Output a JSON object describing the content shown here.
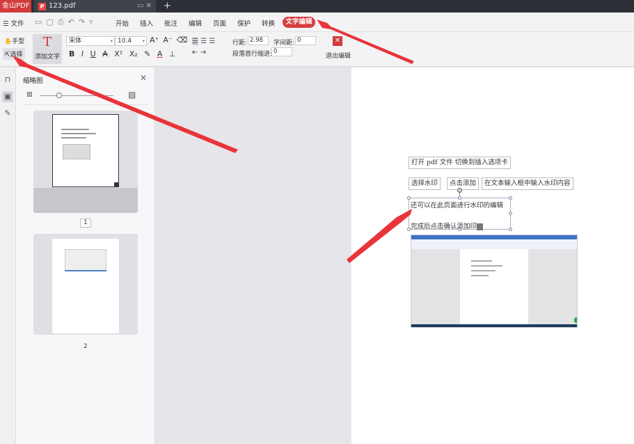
{
  "titlebar": {
    "app_name": "金山PDF",
    "doc_tab_title": "123.pdf",
    "tab_controls": "▭ ✕",
    "new_tab": "+"
  },
  "menubar": {
    "file": "☰ 文件",
    "tabs": [
      {
        "label": "开始"
      },
      {
        "label": "插入"
      },
      {
        "label": "批注"
      },
      {
        "label": "编辑"
      },
      {
        "label": "页面"
      },
      {
        "label": "保护"
      },
      {
        "label": "转换"
      }
    ],
    "active_tab": "文字编辑"
  },
  "ribbon": {
    "hand": "手型",
    "select": "选择",
    "add_text": "添加文字",
    "font_family": "宋体",
    "font_size": "10.4",
    "line_spacing_label": "行距:",
    "line_spacing_value": "2.98",
    "char_spacing_label": "字间距:",
    "char_spacing_value": "0",
    "indent_label": "段落首行缩进:",
    "indent_value": "0",
    "exit_edit": "退出编辑",
    "format_buttons": [
      "B",
      "I",
      "U",
      "A",
      "X²",
      "X₂"
    ]
  },
  "thumbnail_panel": {
    "title": "缩略图",
    "pages": [
      {
        "label": "1"
      },
      {
        "label": "2"
      }
    ]
  },
  "document": {
    "lines": [
      {
        "text": "打开 pdf 文件   切换到插入选项卡"
      },
      {
        "text": "选择水印"
      },
      {
        "text": "点击添加"
      },
      {
        "text": "在文本输入框中输入水印内容"
      },
      {
        "text": "还可以在此页面进行水印的编辑"
      },
      {
        "text": "完成后点击确认添加印"
      }
    ]
  },
  "colors": {
    "accent_red": "#d63d3d",
    "arrow_red": "#e8343a"
  }
}
